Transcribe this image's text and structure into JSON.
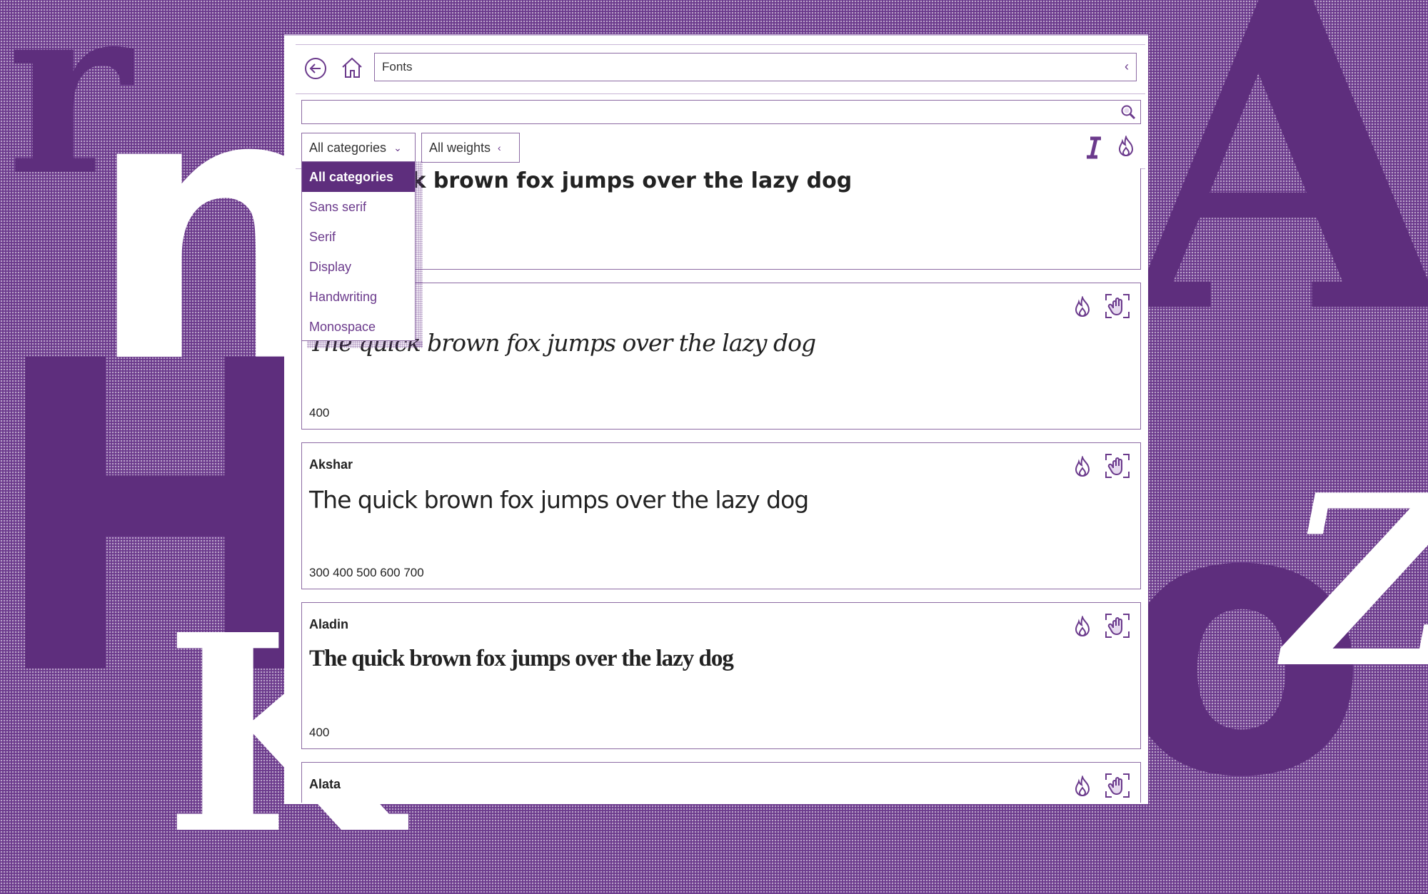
{
  "address_bar": {
    "value": "Fonts"
  },
  "search": {
    "value": "",
    "placeholder": ""
  },
  "filters": {
    "category_selected": "All categories",
    "weight_selected": "All weights"
  },
  "dropdown": {
    "options": [
      "All categories",
      "Sans serif",
      "Serif",
      "Display",
      "Handwriting",
      "Monospace"
    ],
    "active_index": 0
  },
  "cards": [
    {
      "name": "",
      "sample": "The quick brown fox jumps over the lazy dog",
      "weights": ""
    },
    {
      "name": "",
      "sample": "The quick brown fox jumps over the lazy dog",
      "weights": "400"
    },
    {
      "name": "Akshar",
      "sample": "The quick brown fox jumps over the lazy dog",
      "weights": "300 400 500 600 700"
    },
    {
      "name": "Aladin",
      "sample": "The quick brown fox jumps over the lazy dog",
      "weights": "400"
    },
    {
      "name": "Alata",
      "sample": "",
      "weights": ""
    }
  ],
  "icons": {
    "back": "arrow-left-circle-icon",
    "home": "home-icon",
    "collapse": "chevron-left-icon",
    "search": "search-icon",
    "italic": "italic-icon",
    "flame": "flame-icon",
    "hand": "hand-select-icon"
  },
  "colors": {
    "accent": "#6b3a8c",
    "accent_dark": "#5e2e7d",
    "border": "#8c6aa3"
  }
}
